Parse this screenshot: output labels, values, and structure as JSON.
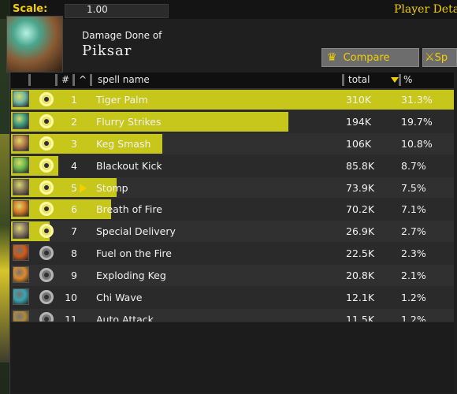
{
  "topbar": {
    "scale_label": "Scale:",
    "scale_value": "1.00",
    "player_details": "Player Deta"
  },
  "header": {
    "subtitle": "Damage Done of",
    "player_name": "Piksar",
    "spell_icon": "brewmaster-keg-icon",
    "compare_label": "Compare",
    "compare_icon": "crown-icon",
    "sp_label": "Sp",
    "sp_icon": "crossed-swords-icon"
  },
  "columns": {
    "num": "#",
    "caret": "^",
    "name": "spell name",
    "total": "total",
    "pct": "%"
  },
  "colors": {
    "bar": "#c7c71b",
    "accent": "#f2d000"
  },
  "rows": [
    {
      "rank": "1",
      "name": "Tiger Palm",
      "total": "310K",
      "pct": "31.3%",
      "share": 1.0,
      "enabled": true,
      "icon": "tiger-palm-icon",
      "icon_color": "#6fb8a1"
    },
    {
      "rank": "2",
      "name": "Flurry Strikes",
      "total": "194K",
      "pct": "19.7%",
      "share": 0.626,
      "enabled": true,
      "icon": "flurry-strikes-icon",
      "icon_color": "#3e9b82"
    },
    {
      "rank": "3",
      "name": "Keg Smash",
      "total": "106K",
      "pct": "10.8%",
      "share": 0.342,
      "enabled": true,
      "icon": "keg-smash-icon",
      "icon_color": "#b67a4a"
    },
    {
      "rank": "4",
      "name": "Blackout Kick",
      "total": "85.8K",
      "pct": "8.7%",
      "share": 0.0,
      "enabled": true,
      "icon": "blackout-kick-icon",
      "icon_color": "#6ab94a"
    },
    {
      "rank": "5",
      "name": "Stomp",
      "total": "73.9K",
      "pct": "7.5%",
      "share": 0.238,
      "enabled": true,
      "selected": true,
      "icon": "stomp-icon",
      "icon_color": "#8b7a5a"
    },
    {
      "rank": "6",
      "name": "Breath of Fire",
      "total": "70.2K",
      "pct": "7.1%",
      "share": 0.226,
      "enabled": true,
      "icon": "breath-of-fire-icon",
      "icon_color": "#d77a2a"
    },
    {
      "rank": "7",
      "name": "Special Delivery",
      "total": "26.9K",
      "pct": "2.7%",
      "share": 0.087,
      "enabled": true,
      "icon": "special-delivery-icon",
      "icon_color": "#8a7a6a"
    },
    {
      "rank": "8",
      "name": "Fuel on the Fire",
      "total": "22.5K",
      "pct": "2.3%",
      "share": 0.0,
      "enabled": false,
      "icon": "fuel-on-the-fire-icon",
      "icon_color": "#d05a1a"
    },
    {
      "rank": "9",
      "name": "Exploding Keg",
      "total": "20.8K",
      "pct": "2.1%",
      "share": 0.0,
      "enabled": false,
      "icon": "exploding-keg-icon",
      "icon_color": "#e08a2a"
    },
    {
      "rank": "10",
      "name": "Chi Wave",
      "total": "12.1K",
      "pct": "1.2%",
      "share": 0.0,
      "enabled": false,
      "icon": "chi-wave-icon",
      "icon_color": "#3aa5b0"
    },
    {
      "rank": "11",
      "name": "Auto Attack",
      "total": "11.5K",
      "pct": "1.2%",
      "share": 0.0,
      "enabled": false,
      "icon": "auto-attack-icon",
      "icon_color": "#b08a3a"
    }
  ]
}
